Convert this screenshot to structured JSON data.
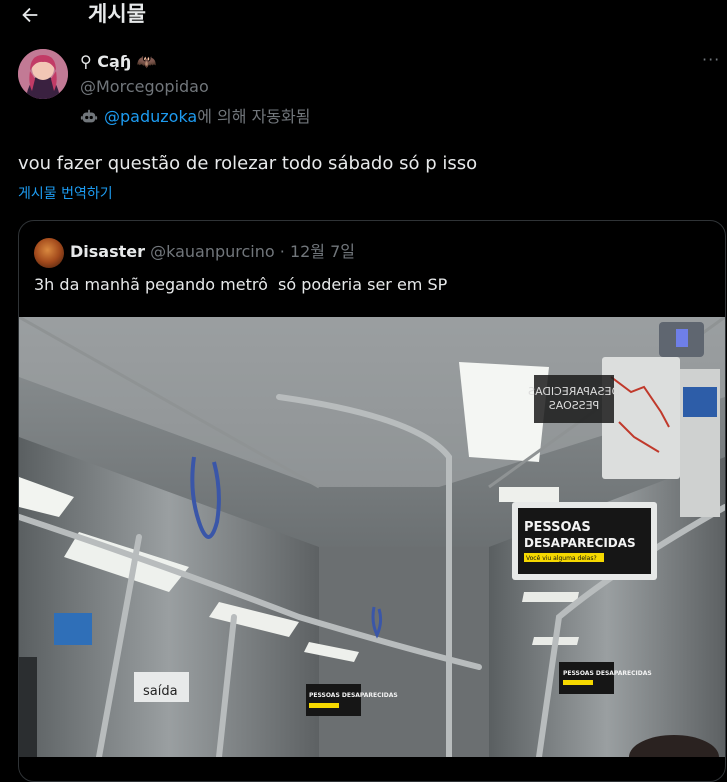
{
  "header": {
    "title": "게시물"
  },
  "post": {
    "author_name": "⚲ Cąɧ 🦇",
    "author_handle": "@Morcegopidao",
    "automated_mention": "@paduzoka",
    "automated_suffix": "에 의해 자동화됨",
    "text": "vou fazer questão de rolezar todo sábado só p isso",
    "translate_label": "게시물 번역하기",
    "more_label": "···"
  },
  "quote": {
    "author_name": "Disaster",
    "author_handle": "@kauanpurcino",
    "date": "· 12월 7일",
    "text": "3h da manhã pegando metrô  só poderia ser em SP",
    "media_signs": {
      "sign_main_line1": "PESSOAS",
      "sign_main_line2": "DESAPARECIDAS",
      "sign_main_sub": "Você viu alguma delas?",
      "sign_small_1": "PESSOAS DESAPARECIDAS",
      "sign_small_2": "PESSOAS DESAPARECIDAS",
      "sign_mirror": "PESSOAS DESAPARECIDAS",
      "door_label": "saída"
    }
  },
  "colors": {
    "background": "#000000",
    "text_primary": "#e7e9ea",
    "text_secondary": "#71767b",
    "accent": "#1d9bf0",
    "border": "#2f3336",
    "sign_yellow": "#f5d800"
  },
  "icons": {
    "back": "arrow-left-icon",
    "robot": "robot-icon",
    "more": "more-horizontal-icon"
  }
}
